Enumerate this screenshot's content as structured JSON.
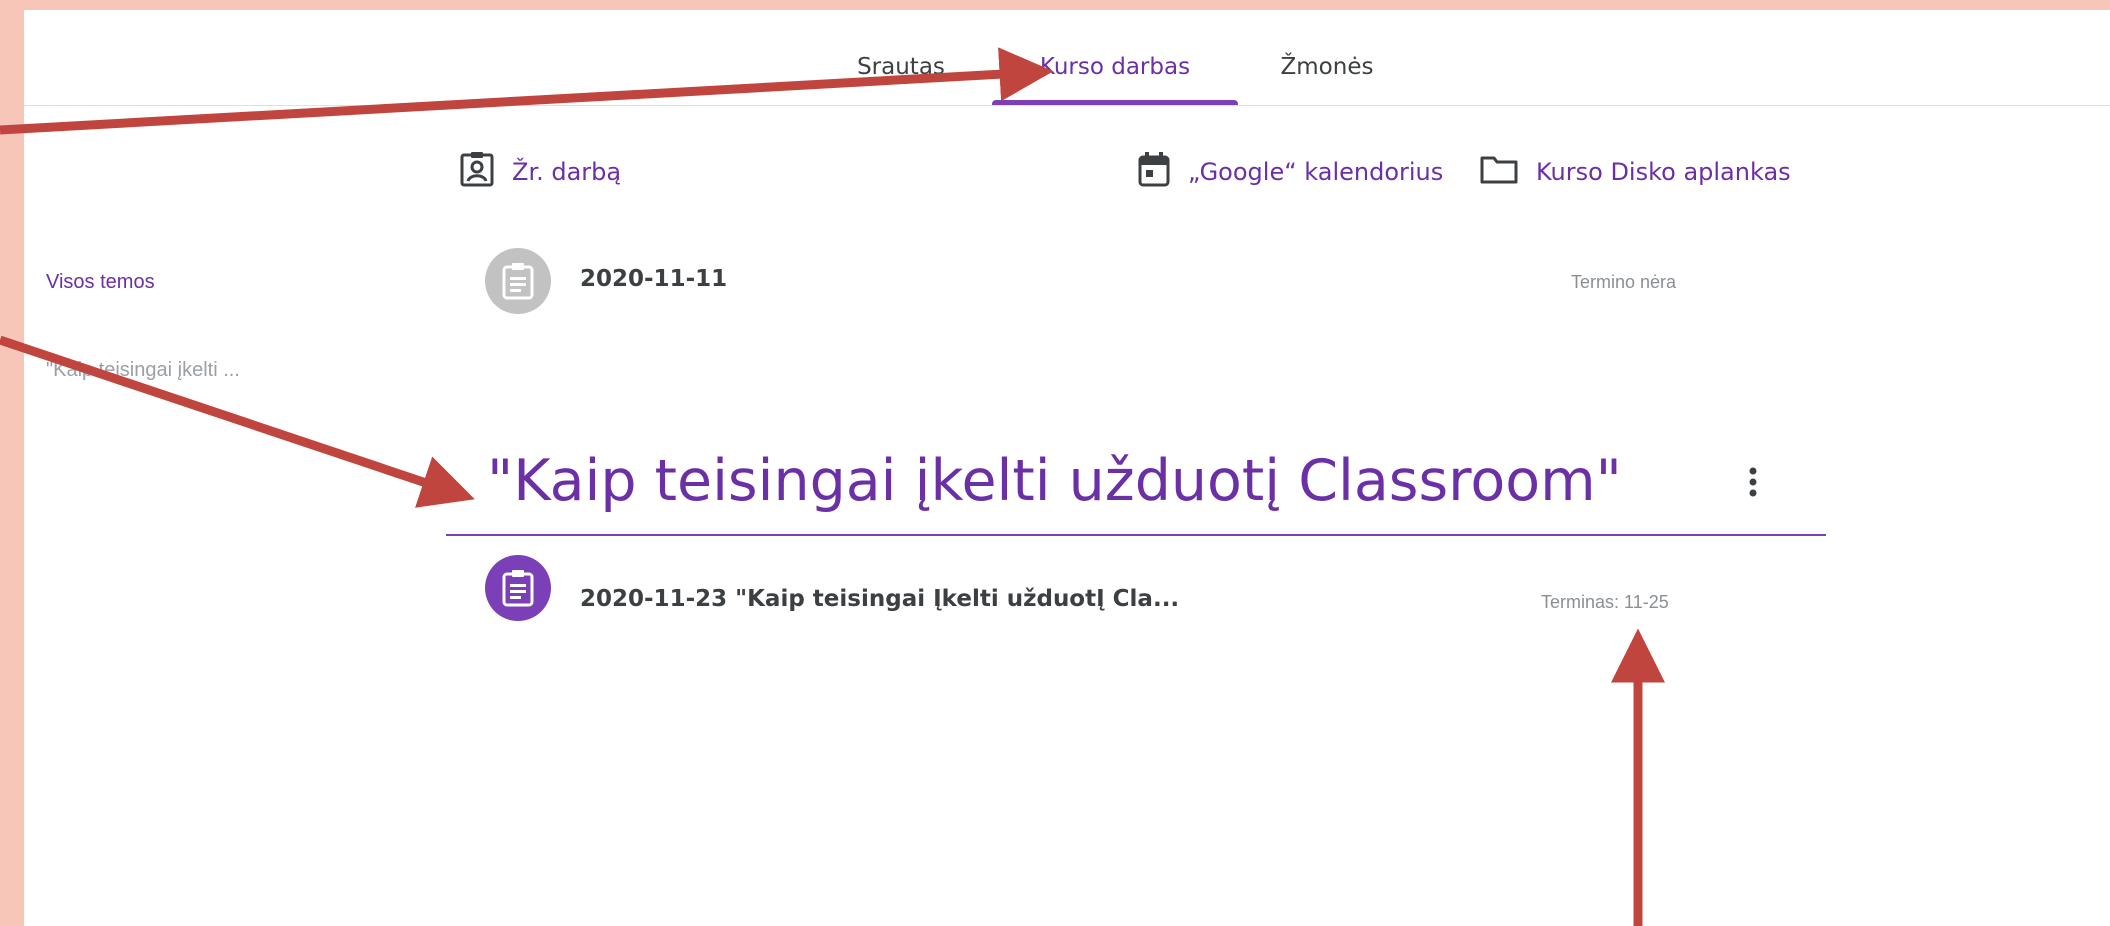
{
  "tabs": [
    {
      "label": "Srautas"
    },
    {
      "label": "Kurso darbas"
    },
    {
      "label": "Žmonės"
    }
  ],
  "actions": {
    "view_work": "Žr. darbą",
    "calendar": "„Google“ kalendorius",
    "drive_folder": "Kurso Disko aplankas"
  },
  "sidebar": {
    "all_topics": "Visos temos",
    "topic_truncated": "\"Kaip teisingai įkelti ..."
  },
  "items": [
    {
      "title": "2020-11-11",
      "due": "Termino nėra"
    }
  ],
  "topic": {
    "title": "\"Kaip teisingai įkelti užduotį Classroom\"",
    "items": [
      {
        "title": "2020-11-23 \"Kaip teisingai Įkelti užduotĮ Cla...",
        "due": "Terminas: 11-25"
      }
    ]
  },
  "colors": {
    "accent": "#7b3fb7",
    "background": "#f8c6b9",
    "arrow": "#c0453f",
    "grey_icon": "#c2c2c2"
  },
  "icons": {
    "view_work": "assignment-ind-icon",
    "calendar": "calendar-icon",
    "drive_folder": "folder-icon",
    "item": "assignment-icon",
    "more": "more-vert-icon"
  }
}
